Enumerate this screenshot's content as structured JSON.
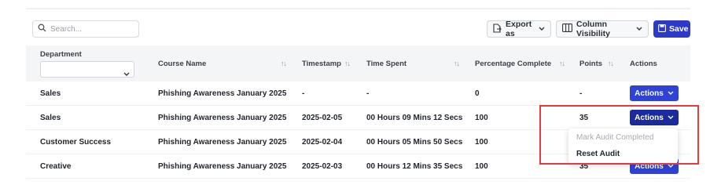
{
  "toolbar": {
    "search_placeholder": "Search...",
    "export_label": "Export as",
    "column_visibility_label": "Column Visibility",
    "save_label": "Save"
  },
  "table": {
    "columns": {
      "department": "Department",
      "course_name": "Course Name",
      "timestamp": "Timestamp",
      "time_spent": "Time Spent",
      "percentage_complete": "Percentage Complete",
      "points": "Points",
      "actions": "Actions"
    },
    "rows": [
      {
        "department": "Sales",
        "course": "Phishing Awareness January 2025",
        "timestamp": "-",
        "time_spent": "-",
        "percent": "0",
        "points": "-",
        "action": "Actions"
      },
      {
        "department": "Sales",
        "course": "Phishing Awareness January 2025",
        "timestamp": "2025-02-05",
        "time_spent": "00 Hours 09 Mins 12 Secs",
        "percent": "100",
        "points": "35",
        "action": "Actions"
      },
      {
        "department": "Customer Success",
        "course": "Phishing Awareness January 2025",
        "timestamp": "2025-02-04",
        "time_spent": "00 Hours 05 Mins 50 Secs",
        "percent": "100",
        "points": "",
        "action": ""
      },
      {
        "department": "Creative",
        "course": "Phishing Awareness January 2025",
        "timestamp": "2025-02-03",
        "time_spent": "00 Hours 12 Mins 35 Secs",
        "percent": "100",
        "points": "35",
        "action": "Actions"
      }
    ]
  },
  "dropdown": {
    "mark_audit_completed": "Mark Audit Completed",
    "reset_audit": "Reset Audit"
  },
  "colors": {
    "primary": "#2e43d6",
    "primary_active": "#1b2a9c",
    "highlight": "#e23b3b"
  }
}
